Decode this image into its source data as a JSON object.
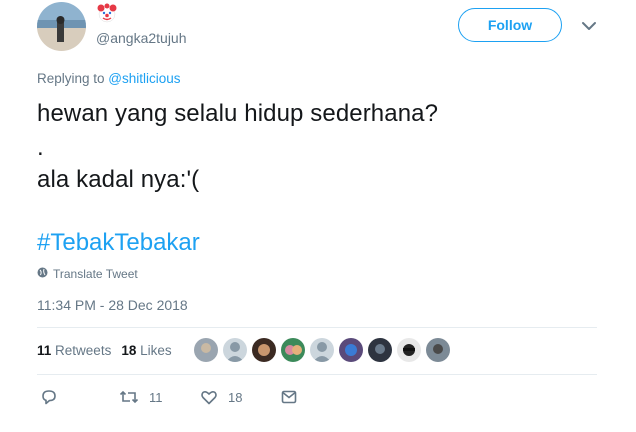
{
  "tweet": {
    "author": {
      "handle": "@angka2tujuh",
      "badge_icon": "clown-face-icon"
    },
    "follow_label": "Follow",
    "replying_prefix": "Replying to ",
    "replying_to": "@shitlicious",
    "text_lines": [
      "hewan yang selalu hidup sederhana?",
      ".",
      "ala kadal nya:'("
    ],
    "hashtag": "#TebakTebakar",
    "translate_label": "Translate Tweet",
    "timestamp": "11:34 PM - 28 Dec 2018",
    "stats": {
      "retweets_count": "11",
      "retweets_label": "Retweets",
      "likes_count": "18",
      "likes_label": "Likes"
    },
    "actions": {
      "retweet_count": "11",
      "like_count": "18"
    },
    "colors": {
      "accent": "#1da1f2",
      "muted": "#657786",
      "text": "#14171a",
      "divider": "#e6ecf0"
    }
  }
}
